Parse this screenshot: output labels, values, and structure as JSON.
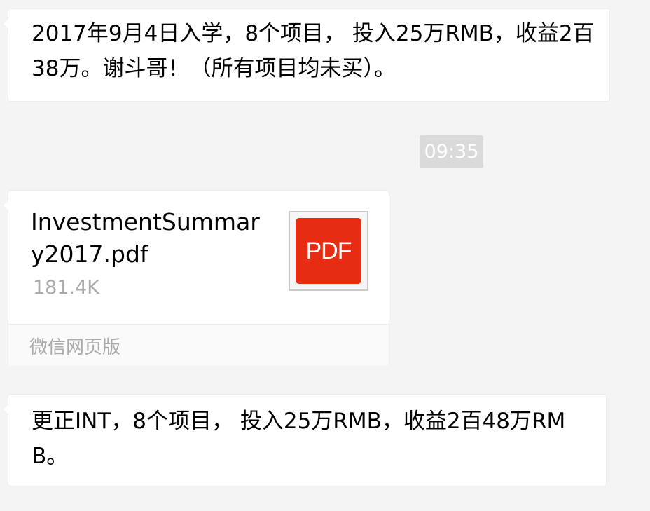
{
  "messages": [
    {
      "text": "2017年9月4日入学，8个项目， 投入25万RMB，收益2百38万。谢斗哥！（所有项目均未买）。"
    },
    {
      "text": "更正INT，8个项目， 投入25万RMB，收益2百48万RMB。"
    }
  ],
  "timestamp": "09:35",
  "file_card": {
    "file_name": "InvestmentSummary2017.pdf",
    "file_size": "181.4K",
    "file_type_label": "PDF",
    "source_label": "微信网页版",
    "icon": "pdf-file-icon",
    "icon_color": "#e62c12"
  },
  "colors": {
    "background": "#f4f4f4",
    "bubble": "#ffffff",
    "timestamp_bg": "#dadada",
    "muted_text": "#aaaaaa"
  }
}
